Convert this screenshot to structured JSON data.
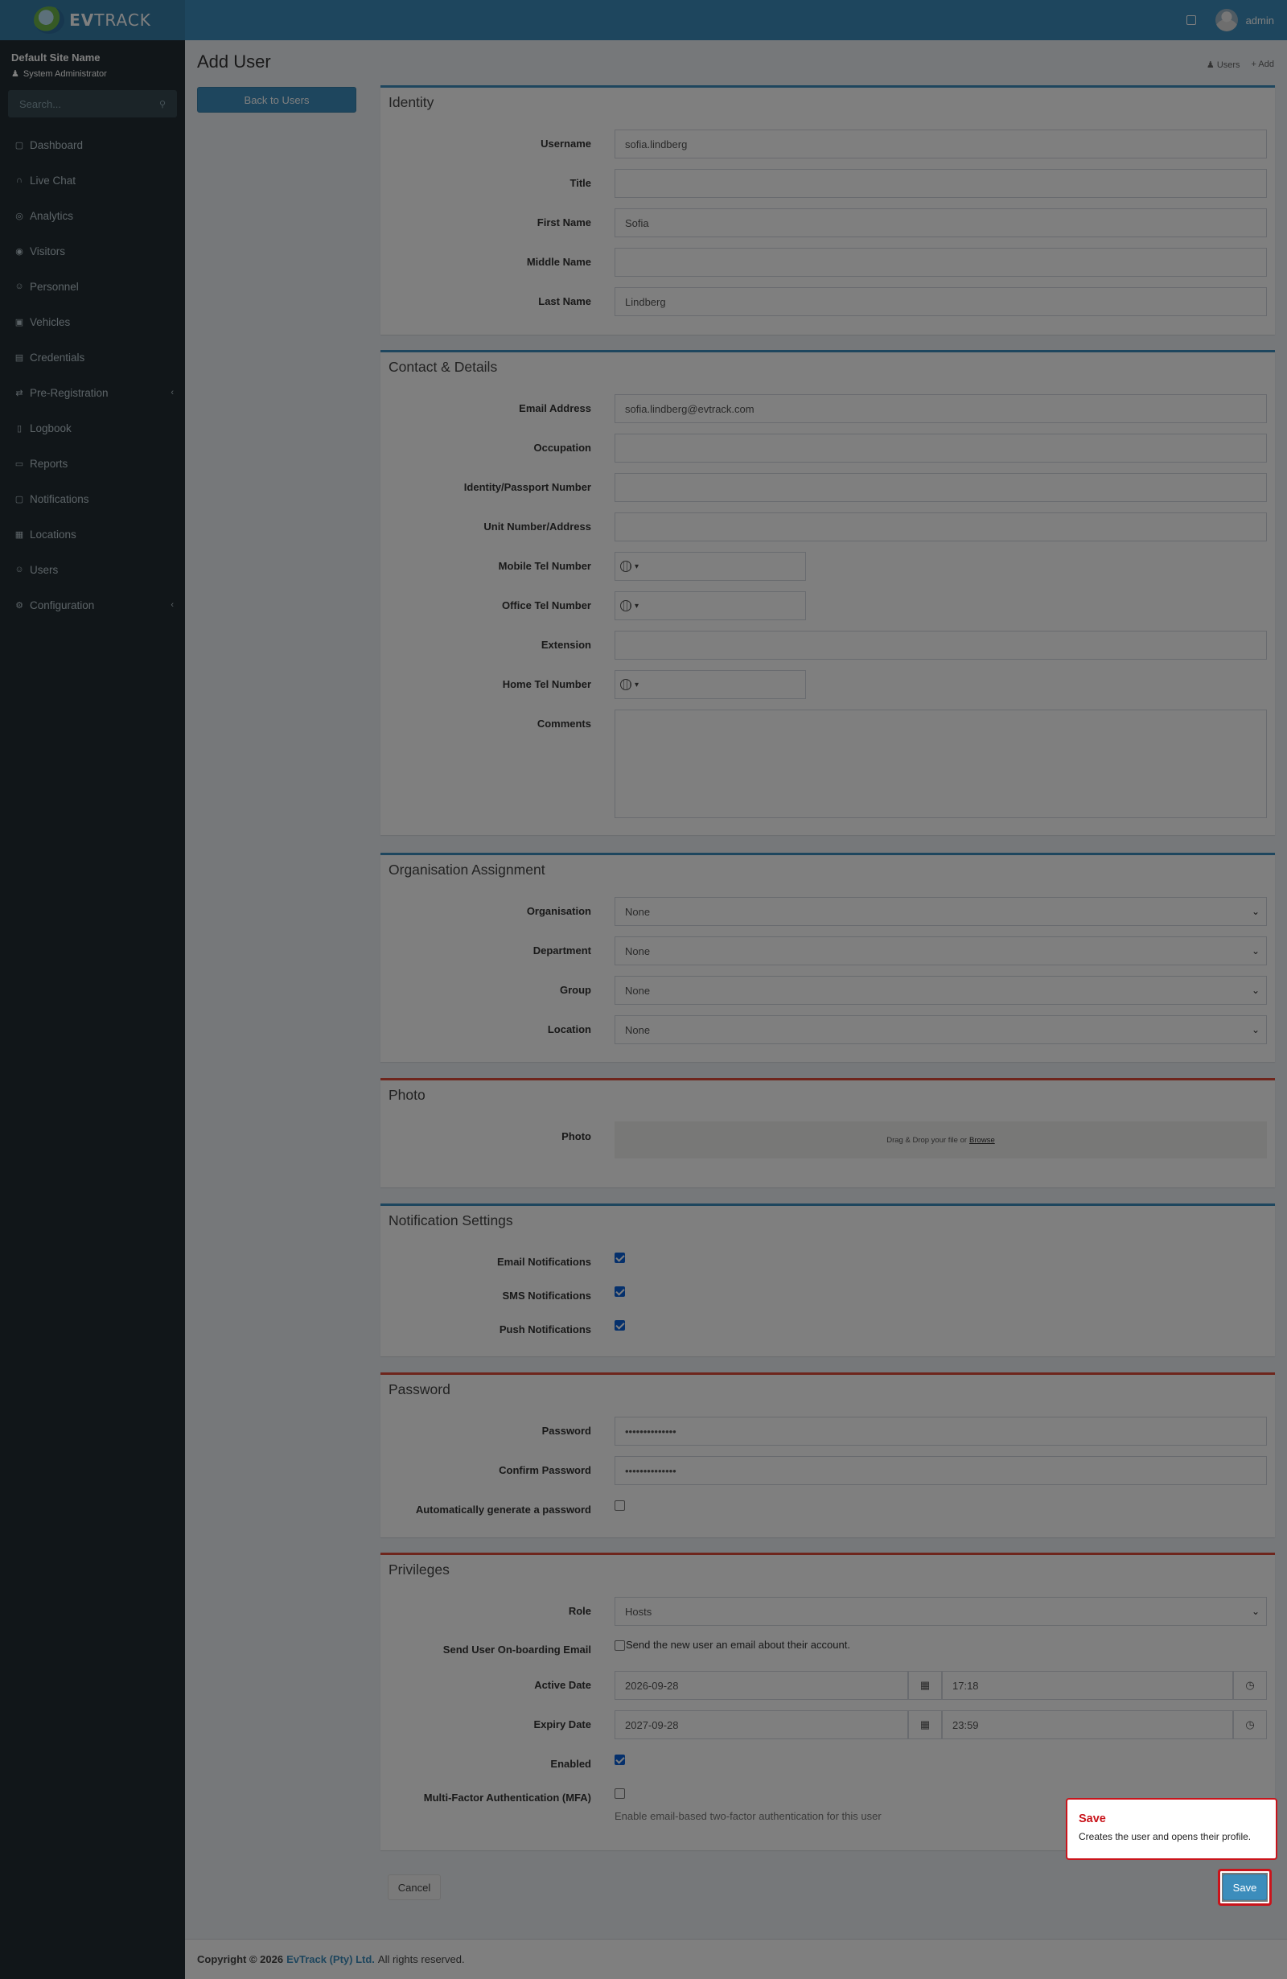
{
  "header": {
    "logo_text_bold": "EV",
    "logo_text": "TRACK",
    "username": "admin"
  },
  "sidebar": {
    "site_name": "Default Site Name",
    "role": "System Administrator",
    "search_placeholder": "Search...",
    "items": [
      {
        "label": "Dashboard",
        "icon": "dashboard-icon"
      },
      {
        "label": "Live Chat",
        "icon": "headset-icon"
      },
      {
        "label": "Analytics",
        "icon": "analytics-icon"
      },
      {
        "label": "Visitors",
        "icon": "eye-icon"
      },
      {
        "label": "Personnel",
        "icon": "user-tie-icon"
      },
      {
        "label": "Vehicles",
        "icon": "car-icon"
      },
      {
        "label": "Credentials",
        "icon": "id-card-icon"
      },
      {
        "label": "Pre-Registration",
        "icon": "exchange-icon"
      },
      {
        "label": "Logbook",
        "icon": "book-icon"
      },
      {
        "label": "Reports",
        "icon": "chart-icon"
      },
      {
        "label": "Notifications",
        "icon": "comments-icon"
      },
      {
        "label": "Locations",
        "icon": "building-icon"
      },
      {
        "label": "Users",
        "icon": "users-icon"
      },
      {
        "label": "Configuration",
        "icon": "gear-icon"
      }
    ]
  },
  "page": {
    "title": "Add User",
    "breadcrumb_users": "Users",
    "breadcrumb_add": "Add",
    "back_label": "Back to Users"
  },
  "identity": {
    "title": "Identity",
    "username_label": "Username",
    "username_value": "sofia.lindberg",
    "title_label": "Title",
    "title_value": "",
    "first_name_label": "First Name",
    "first_name_value": "Sofia",
    "middle_name_label": "Middle Name",
    "middle_name_value": "",
    "last_name_label": "Last Name",
    "last_name_value": "Lindberg"
  },
  "contact": {
    "title": "Contact & Details",
    "email_label": "Email Address",
    "email_value": "sofia.lindberg@evtrack.com",
    "occupation_label": "Occupation",
    "id_label": "Identity/Passport Number",
    "unit_label": "Unit Number/Address",
    "mobile_label": "Mobile Tel Number",
    "office_label": "Office Tel Number",
    "extension_label": "Extension",
    "home_label": "Home Tel Number",
    "comments_label": "Comments"
  },
  "organisation": {
    "title": "Organisation Assignment",
    "organisation_label": "Organisation",
    "organisation_value": "None",
    "department_label": "Department",
    "department_value": "None",
    "group_label": "Group",
    "group_value": "None",
    "location_label": "Location",
    "location_value": "None"
  },
  "photo": {
    "title": "Photo",
    "label": "Photo",
    "drop_text": "Drag & Drop your file or",
    "browse": "Browse"
  },
  "notifications": {
    "title": "Notification Settings",
    "email_label": "Email Notifications",
    "email_checked": true,
    "sms_label": "SMS Notifications",
    "sms_checked": true,
    "push_label": "Push Notifications",
    "push_checked": true
  },
  "password": {
    "title": "Password",
    "password_label": "Password",
    "password_value": "••••••••••••••",
    "confirm_label": "Confirm Password",
    "confirm_value": "••••••••••••••",
    "auto_label": "Automatically generate a password",
    "auto_checked": false
  },
  "privileges": {
    "title": "Privileges",
    "role_label": "Role",
    "role_value": "Hosts",
    "onboard_label": "Send User On-boarding Email",
    "onboard_text": "Send the new user an email about their account.",
    "active_label": "Active Date",
    "active_date": "2026-09-28",
    "active_time": "17:18",
    "expiry_label": "Expiry Date",
    "expiry_date": "2027-09-28",
    "expiry_time": "23:59",
    "enabled_label": "Enabled",
    "enabled_checked": true,
    "mfa_label": "Multi-Factor Authentication (MFA)",
    "mfa_help": "Enable email-based two-factor authentication for this user"
  },
  "actions": {
    "cancel": "Cancel",
    "save": "Save"
  },
  "tooltip": {
    "title": "Save",
    "body": "Creates the user and opens their profile."
  },
  "footer": {
    "prefix": "Copyright © 2026",
    "company": "EvTrack (Pty) Ltd.",
    "suffix": "All rights reserved."
  },
  "colors": {
    "primary": "#3c8dbc",
    "sidebar": "#222d32",
    "danger": "#dd4b39",
    "highlight": "#c9141b"
  }
}
